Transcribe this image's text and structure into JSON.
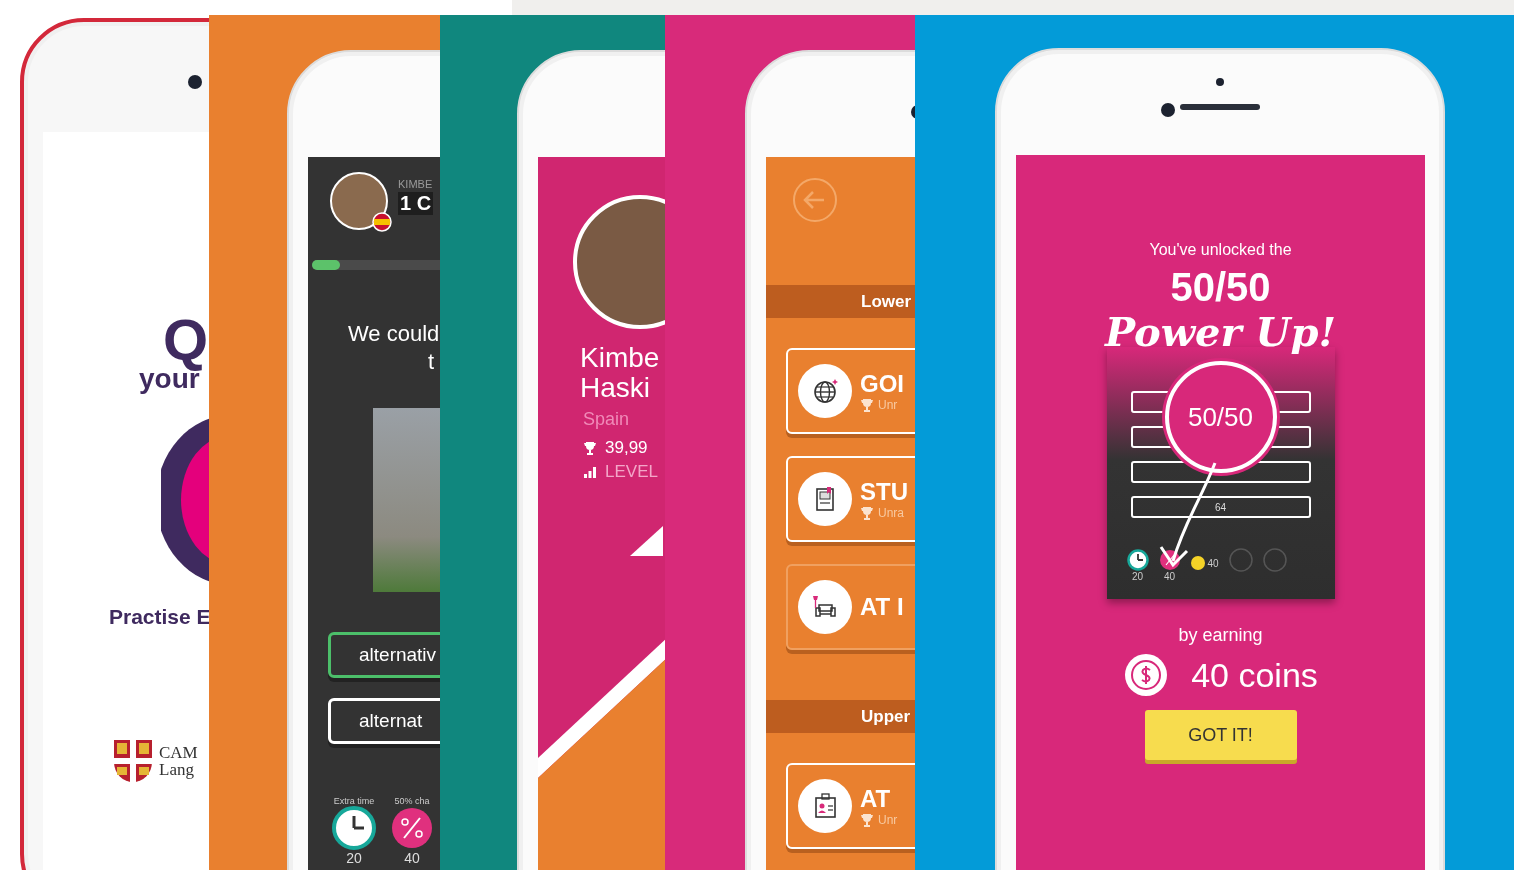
{
  "panels": [
    {
      "kind": "splash",
      "color": "#ffffff",
      "title_letter": "Q",
      "subtitle": "your",
      "tagline": "Practise E",
      "publisher_lines": [
        "CAM",
        "Lang"
      ]
    },
    {
      "kind": "quiz",
      "color": "#e9802f",
      "player_label": "KIMBE",
      "score": "1 C",
      "level": 0.07,
      "question_lines": [
        "We could",
        "t"
      ],
      "answers": [
        {
          "text": "alternativ",
          "selected": true
        },
        {
          "text": "alternat",
          "selected": false
        }
      ],
      "powerups": [
        {
          "kind": "clock",
          "label": "Extra time",
          "cost": "20"
        },
        {
          "kind": "fifty",
          "label": "50% cha",
          "cost": "40"
        }
      ]
    },
    {
      "kind": "profile",
      "color": "#10877e",
      "name_lines": [
        "Kimbe",
        "Haski"
      ],
      "country": "Spain",
      "points": "39,99",
      "level_label": "LEVEL"
    },
    {
      "kind": "topics",
      "color": "#d82a7a",
      "sections": [
        {
          "title": "Lower",
          "topics": [
            {
              "kind": "globe",
              "title": "GOI",
              "status": "Unr",
              "outlined": true
            },
            {
              "kind": "book",
              "title": "STU",
              "status": "Unra",
              "outlined": true
            },
            {
              "kind": "chair",
              "title": "AT I",
              "outlined": false
            }
          ]
        },
        {
          "title": "Upper",
          "topics": [
            {
              "kind": "badge",
              "title": "AT",
              "status": "Unr",
              "outlined": true
            }
          ]
        }
      ]
    },
    {
      "kind": "powerup",
      "color": "#039bd8",
      "intro": "You've unlocked the",
      "headline": "50/50",
      "script_title": "Power Up!",
      "preview": {
        "badge": "50/50",
        "answer_value": "64",
        "clock_cost": "20",
        "fifty_cost": "40",
        "coins": "40"
      },
      "earn_label": "by earning",
      "reward": "40 coins",
      "button": "GOT IT!"
    }
  ]
}
